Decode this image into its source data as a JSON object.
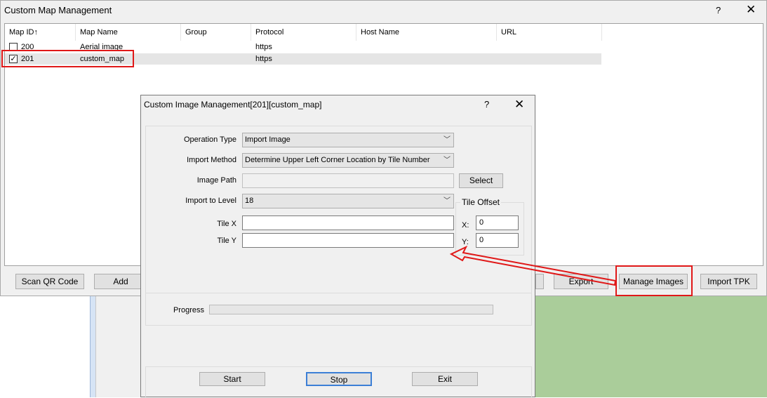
{
  "main": {
    "title": "Custom Map Management",
    "help": "?",
    "close": "✕",
    "columns": [
      "Map ID↑",
      "Map Name",
      "Group",
      "Protocol",
      "Host Name",
      "URL"
    ],
    "rows": [
      {
        "id": "200",
        "name": "Aerial image",
        "group": "",
        "protocol": "https",
        "host": "",
        "url": "",
        "checked": false
      },
      {
        "id": "201",
        "name": "custom_map",
        "group": "",
        "protocol": "https",
        "host": "",
        "url": "",
        "checked": true
      }
    ],
    "buttons": {
      "scan": "Scan QR Code",
      "add": "Add",
      "export": "Export",
      "manage": "Manage Images",
      "import_tpk": "Import TPK"
    }
  },
  "dialog": {
    "title": "Custom Image Management[201][custom_map]",
    "help": "?",
    "close": "✕",
    "operation_type_label": "Operation Type",
    "operation_type_value": "Import Image",
    "import_method_label": "Import Method",
    "import_method_value": "Determine Upper Left Corner Location by Tile Number",
    "image_path_label": "Image Path",
    "image_path_value": "",
    "select_button": "Select",
    "import_level_label": "Import to Level",
    "import_level_value": "18",
    "tile_offset_title": "Tile Offset",
    "x_label": "X:",
    "x_value": "0",
    "y_label": "Y:",
    "y_value": "0",
    "tile_x_label": "Tile X",
    "tile_x_value": "",
    "tile_y_label": "Tile Y",
    "tile_y_value": "",
    "progress_label": "Progress",
    "progress_value": 0,
    "start_button": "Start",
    "stop_button": "Stop",
    "exit_button": "Exit"
  },
  "colors": {
    "annotation_red": "#e01818",
    "map_green": "#aacd9a"
  },
  "icons": {
    "checkbox_checked": "✓",
    "dropdown": "﹀"
  }
}
